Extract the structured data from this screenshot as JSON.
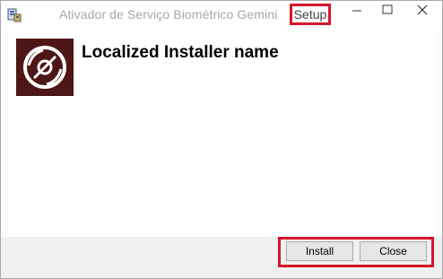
{
  "window": {
    "title": "Ativador de Serviço Biométrico Gemini ",
    "title_highlight": "Setup"
  },
  "installer": {
    "heading": "Localized Installer name"
  },
  "buttons": {
    "install_label": "Install",
    "close_label": "Close"
  },
  "icons": {
    "app": "installer-app-icon",
    "logo": "disc-logo-icon",
    "minimize": "minimize-icon",
    "maximize": "maximize-icon",
    "close": "close-icon"
  },
  "colors": {
    "highlight": "#d6162a",
    "logo_bg": "#3a1414"
  }
}
